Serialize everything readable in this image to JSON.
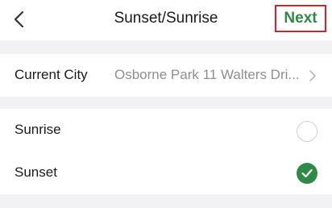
{
  "navbar": {
    "back_icon": "chevron-left-icon",
    "title": "Sunset/Sunrise",
    "next_label": "Next"
  },
  "city": {
    "label": "Current City",
    "value": "Osborne Park 11 Walters Dri...",
    "chevron_icon": "chevron-right-icon"
  },
  "options": [
    {
      "label": "Sunrise",
      "selected": false
    },
    {
      "label": "Sunset",
      "selected": true
    }
  ],
  "colors": {
    "accent_green": "#2f8a45",
    "highlight_red": "#d8232a",
    "background": "#f2f2f4"
  }
}
